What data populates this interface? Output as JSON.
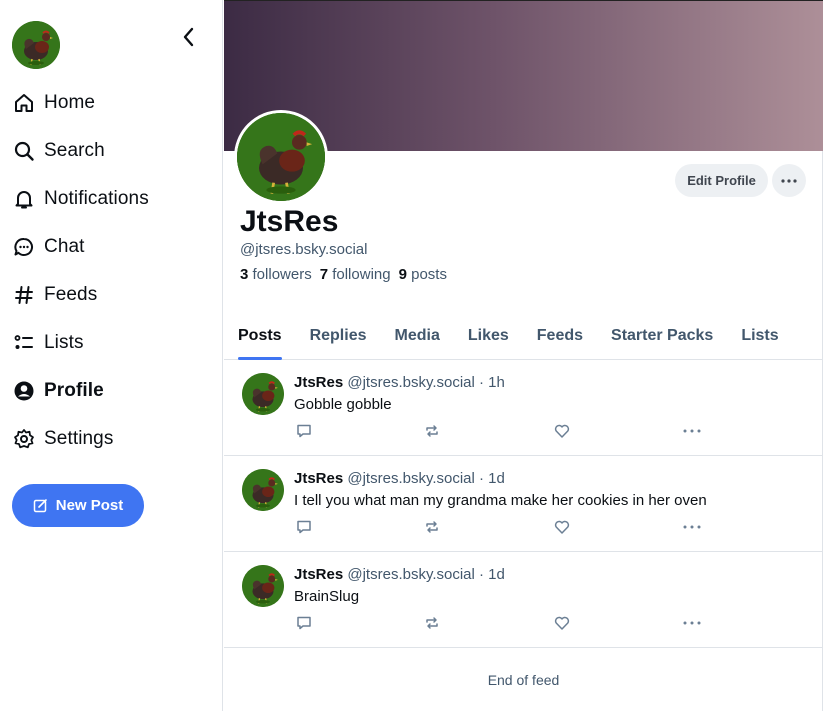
{
  "sidebar": {
    "avatar_alt": "JtsRes avatar",
    "nav": [
      {
        "label": "Home",
        "icon": "home-icon"
      },
      {
        "label": "Search",
        "icon": "search-icon"
      },
      {
        "label": "Notifications",
        "icon": "bell-icon"
      },
      {
        "label": "Chat",
        "icon": "chat-icon"
      },
      {
        "label": "Feeds",
        "icon": "hash-icon"
      },
      {
        "label": "Lists",
        "icon": "list-icon"
      },
      {
        "label": "Profile",
        "icon": "user-icon",
        "active": true
      },
      {
        "label": "Settings",
        "icon": "gear-icon"
      }
    ],
    "new_post_label": "New Post"
  },
  "profile": {
    "display_name": "JtsRes",
    "handle": "@jtsres.bsky.social",
    "followers_count": "3",
    "followers_label": "followers",
    "following_count": "7",
    "following_label": "following",
    "posts_count": "9",
    "posts_label": "posts",
    "edit_label": "Edit Profile"
  },
  "tabs": [
    {
      "label": "Posts",
      "active": true
    },
    {
      "label": "Replies"
    },
    {
      "label": "Media"
    },
    {
      "label": "Likes"
    },
    {
      "label": "Feeds"
    },
    {
      "label": "Starter Packs"
    },
    {
      "label": "Lists"
    }
  ],
  "posts": [
    {
      "name": "JtsRes",
      "meta": "@jtsres.bsky.social · 1h",
      "text": "Gobble gobble"
    },
    {
      "name": "JtsRes",
      "meta": "@jtsres.bsky.social · 1d",
      "text": "I tell you what man my grandma make her cookies in her oven"
    },
    {
      "name": "JtsRes",
      "meta": "@jtsres.bsky.social · 1d",
      "text": "BrainSlug"
    }
  ],
  "feed_end": "End of feed",
  "colors": {
    "accent": "#3f75f2",
    "text": "#0b0f14",
    "muted": "#42576c",
    "border": "#dfe3e8",
    "banner_start": "#3c2b44",
    "banner_end": "#ad8f98"
  }
}
